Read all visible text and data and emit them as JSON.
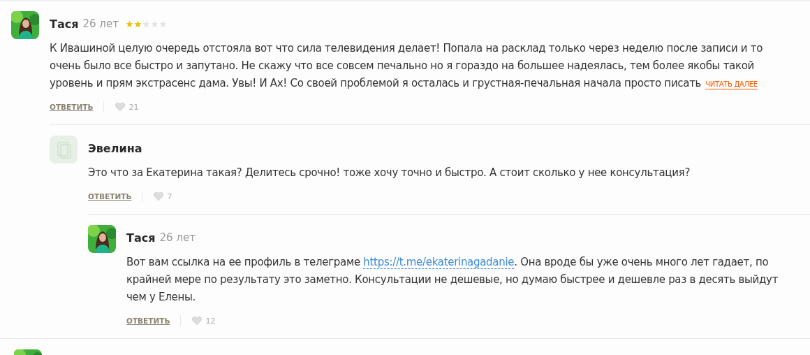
{
  "comments": [
    {
      "author": "Тася",
      "age": "26 лет",
      "avatar_photo": true,
      "stars": 2,
      "text": "К Ивашиной целую очередь отстояла вот что сила телевидения делает! Попала на расклад только через неделю после записи и то очень было все быстро и запутано. Не скажу что все совсем печально но я гораздо на большее надеялась, тем более якобы такой уровень и прям экстрасенс дама. Увы! И Ах! Со своей проблемой я осталась и грустная-печальная начала просто писать",
      "read_more": "ЧИТАТЬ ДАЛЕЕ",
      "reply": "ОТВЕТИТЬ",
      "likes": "21",
      "children": [
        {
          "author": "Эвелина",
          "avatar_photo": false,
          "text": "Это что за Екатерина такая? Делитесь срочно! тоже хочу точно и быстро. А стоит сколько у нее консультация?",
          "reply": "ОТВЕТИТЬ",
          "likes": "7",
          "children": [
            {
              "author": "Тася",
              "age": "26 лет",
              "avatar_photo": true,
              "text_before": "Вот вам ссылка на ее профиль в телеграме",
              "link": "https://t.me/ekaterinagadanie",
              "text_after": ". Она вроде бы уже очень много лет гадает, по крайней мере по результату это заметно. Консультации не дешевые, но думаю быстрее и дешевле раз в десять выйдут чем у Елены.",
              "reply": "ОТВЕТИТЬ",
              "likes": "12"
            }
          ]
        }
      ]
    },
    {
      "avatar_photo": true
    }
  ]
}
